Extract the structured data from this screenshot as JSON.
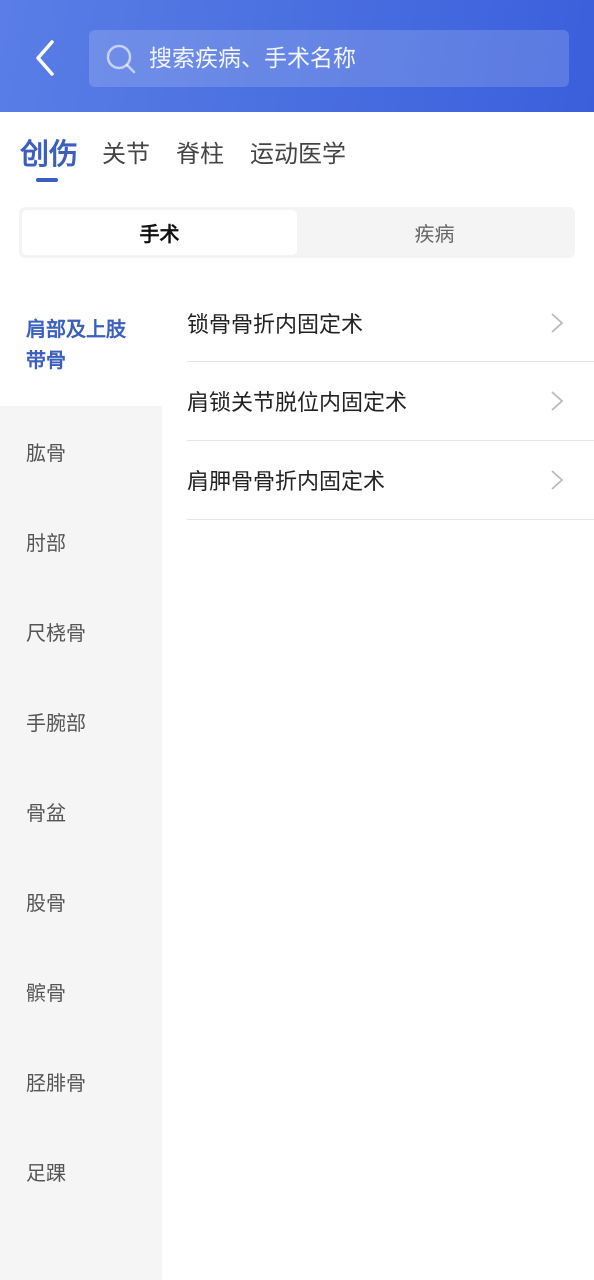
{
  "header": {
    "search_placeholder": "搜索疾病、手术名称",
    "back_icon": "chevron-left-icon",
    "search_icon": "search-icon",
    "colors": {
      "header_start": "#5a7ee6",
      "header_end": "#3b5fdc",
      "accent": "#3a5fbf"
    }
  },
  "category_tabs": [
    {
      "label": "创伤",
      "active": true
    },
    {
      "label": "关节",
      "active": false
    },
    {
      "label": "脊柱",
      "active": false
    },
    {
      "label": "运动医学",
      "active": false
    }
  ],
  "segment": [
    {
      "label": "手术",
      "active": true
    },
    {
      "label": "疾病",
      "active": false
    }
  ],
  "sidebar": [
    {
      "label": "肩部及上肢带骨",
      "active": true
    },
    {
      "label": "肱骨"
    },
    {
      "label": "肘部"
    },
    {
      "label": "尺桡骨"
    },
    {
      "label": "手腕部"
    },
    {
      "label": "骨盆"
    },
    {
      "label": "股骨"
    },
    {
      "label": "髌骨"
    },
    {
      "label": "胫腓骨"
    },
    {
      "label": "足踝"
    }
  ],
  "list": [
    {
      "label": "锁骨骨折内固定术"
    },
    {
      "label": "肩锁关节脱位内固定术"
    },
    {
      "label": "肩胛骨骨折内固定术"
    }
  ]
}
